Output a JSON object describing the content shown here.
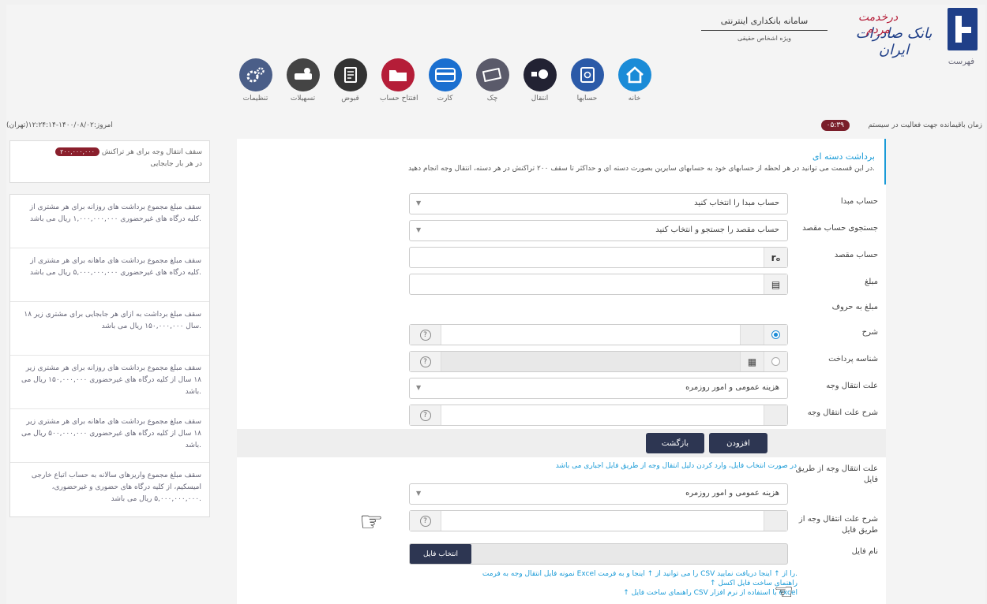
{
  "header": {
    "menu_label": "فهرست",
    "bank_name": "بانک صادرات ایران",
    "bank_slogan": "درخدمت مردم",
    "system_title": "سامانه بانکداری اینترنتی",
    "system_subtitle": "ویژه اشخاص حقیقی"
  },
  "nav": [
    {
      "label": "خانه",
      "color": "#1a8bd7",
      "icon": "home-icon"
    },
    {
      "label": "حسابها",
      "color": "#2b5aa8",
      "icon": "safe-icon"
    },
    {
      "label": "انتقال",
      "color": "#222233",
      "icon": "transfer-icon"
    },
    {
      "label": "چک",
      "color": "#5a5a6a",
      "icon": "cheque-icon"
    },
    {
      "label": "کارت",
      "color": "#1a6fd0",
      "icon": "card-icon"
    },
    {
      "label": "افتتاح حساب",
      "color": "#b51d38",
      "icon": "folder-icon"
    },
    {
      "label": "قبوض",
      "color": "#333333",
      "icon": "bill-icon"
    },
    {
      "label": "تسهیلات",
      "color": "#444444",
      "icon": "loan-icon"
    },
    {
      "label": "تنظیمات",
      "color": "#4a5e88",
      "icon": "gear-icon"
    }
  ],
  "status": {
    "session_text": "زمان باقیمانده جهت فعالیت در سیستم",
    "timer": "۰۵:۳۹",
    "today_text": "امروز:۱۴۰۰/۰۸/۰۲-۱۲:۲۴:۱۴(تهران)"
  },
  "sidebar": {
    "top_limit": {
      "text": "سقف انتقال وجه برای هر تراکنش",
      "badge": "۲۰۰,۰۰۰,۰۰۰",
      "suffix": "در هر بار جابجایی"
    },
    "items": [
      "سقف مبلغ مجموع برداشت های روزانه برای هر مشتری از کلیه درگاه های غیرحضوری ۱,۰۰۰,۰۰۰,۰۰۰ ریال می باشد.",
      "سقف مبلغ مجموع برداشت های ماهانه برای هر مشتری از کلیه درگاه های غیرحضوری ۵,۰۰۰,۰۰۰,۰۰۰ ریال می باشد.",
      "سقف مبلغ برداشت به ازای هر جابجایی برای مشتری زیر ۱۸ سال ۱۵۰,۰۰۰,۰۰۰ ریال می باشد.",
      "سقف مبلغ مجموع برداشت های روزانه برای هر مشتری زیر ۱۸ سال از کلیه درگاه های غیرحضوری ۱۵۰,۰۰۰,۰۰۰ ریال می باشد.",
      "سقف مبلغ مجموع برداشت های ماهانه برای هر مشتری زیر ۱۸ سال از کلیه درگاه های غیرحضوری ۵۰۰,۰۰۰,۰۰۰ ریال می باشد.",
      "سقف مبلغ مجموع واریزهای سالانه به حساب اتباع خارجی امیسکیم، از کلیه درگاه های حضوری و غیرحضوری، ۵,۰۰۰,۰۰۰,۰۰۰ ریال می باشد."
    ]
  },
  "main": {
    "title": "برداشت دسته ای",
    "description": "در این قسمت می توانید در هر لحظه از حسابهای خود به حسابهای سایرین بصورت دسته ای و حداکثر تا سقف ۲۰۰ تراکنش در هر دسته، انتقال وجه انجام دهید.",
    "labels": {
      "source": "حساب مبدا",
      "dest_search": "جستجوی حساب مقصد",
      "dest": "حساب مقصد",
      "amount": "مبلغ",
      "amount_words": "مبلغ به حروف",
      "desc": "شرح",
      "payment_id": "شناسه پرداخت",
      "reason": "علت انتقال وجه",
      "reason_desc": "شرح علت انتقال وجه",
      "file_reason": "علت انتقال وجه از طریق فایل",
      "file_reason_desc": "شرح علت انتقال وجه از طریق فایل",
      "file_name": "نام فایل"
    },
    "placeholders": {
      "source": "حساب مبدا را انتخاب کنید",
      "dest_search": "حساب مقصد را جستجو و انتخاب کنید"
    },
    "reason_value": "هزینه عمومی و امور روزمره",
    "file_reason_value": "هزینه عمومی و امور روزمره",
    "add_button": "افزودن",
    "back_button": "بازگشت",
    "file_note": "در صورت انتخاب فایل، وارد کردن دلیل انتقال وجه از طریق فایل اجباری می باشد",
    "choose_file": "انتخاب فایل",
    "links": [
      "نمونه فایل انتقال وجه به فرمت Excel را می توانید از ↑ اینجا و به فرمت CSV را از ↑ اینجا دریافت نمایید.",
      "↑ راهنمای ساخت فایل اکسل",
      "↑ راهنمای ساخت فایل CSV با استفاده از نرم افزار excel"
    ]
  }
}
